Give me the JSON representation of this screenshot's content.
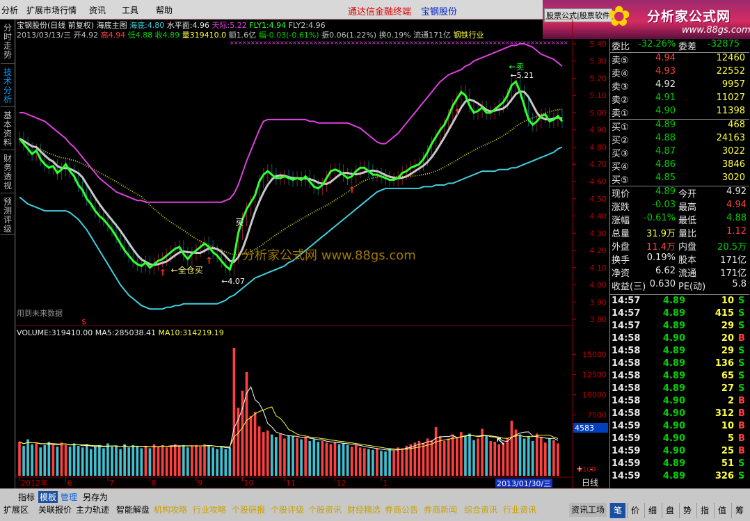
{
  "menu": {
    "items": [
      "分析",
      "扩展市场行情",
      "资讯",
      "工具",
      "帮助"
    ],
    "brand": "通达信金融终端",
    "stock_name": "宝钢股份"
  },
  "logo": {
    "ad_label": "股票公式|股票软件",
    "brand": "分析家公式网",
    "url": "www.88gs.com"
  },
  "left_tabs": [
    "分时走势",
    "技术分析",
    "基本资料",
    "财务透视",
    "预测评级"
  ],
  "chart": {
    "title_line": {
      "name": "宝钢股份(日线 前复权)",
      "indicator": "海底主图",
      "haidi_label": "海底:",
      "haidi": "4.80",
      "shuiping_label": "水平面:",
      "shuiping": "4.96",
      "tianji_label": "天际:",
      "tianji": "5.22",
      "fly1_label": "FLY1:",
      "fly1": "4.94",
      "fly2_label": "FLY2:",
      "fly2": "4.96"
    },
    "ohlc_line": {
      "date": "2013/03/13/三",
      "open_label": "开",
      "open": "4.92",
      "high_label": "高",
      "high": "4.94",
      "low_label": "低",
      "low": "4.88",
      "close_label": "收",
      "close": "4.89",
      "vol_label": "量",
      "vol": "319410.0",
      "amount": "额1.6亿",
      "change_label": "幅",
      "change": "-0.03(-0.61%)",
      "amplitude": "振0.06(1.22%)",
      "turnover": "换0.19%",
      "float": "流通171亿",
      "sector": "钢铁行业"
    },
    "y_ticks": [
      "5.40",
      "5.30",
      "5.20",
      "5.10",
      "5.00",
      "4.90",
      "4.80",
      "4.70",
      "4.60",
      "4.50",
      "4.40",
      "4.30",
      "4.20",
      "4.10",
      "4.00",
      "3.90",
      "3.80"
    ],
    "annotations": {
      "buy_label": "买",
      "sell_label": "卖",
      "full_position_buy": "全仓买",
      "low_value": "4.07",
      "high_value": "5.21",
      "future_data_note": "用到未来数据",
      "watermark": "分析家公式网 www.88gs.com"
    },
    "volume_line": {
      "vol_label": "VOLUME:",
      "vol": "319410.00",
      "ma5_label": "MA5:",
      "ma5": "285038.41",
      "ma10_label": "MA10:",
      "ma10": "314219.19"
    },
    "vol_ticks": [
      "15000",
      "12500",
      "10000",
      "7500"
    ],
    "vol_cursor": "4583",
    "vol_unit": "X100",
    "x_ticks": [
      "2012年",
      "6",
      "7",
      "8",
      "9",
      "10",
      "11",
      "12",
      "1"
    ],
    "date_cursor": "2013/01/30/三",
    "period": "日线",
    "zoom_plus": "+",
    "zoom_minus": "-"
  },
  "chart_data": {
    "type": "line",
    "title": "宝钢股份(日线 前复权)",
    "ylim": [
      3.78,
      5.42
    ],
    "series": [
      {
        "name": "收",
        "values": [
          4.85,
          4.82,
          4.79,
          4.76,
          4.78,
          4.73,
          4.7,
          4.68,
          4.69,
          4.65,
          4.67,
          4.7,
          4.66,
          4.63,
          4.58,
          4.55,
          4.5,
          4.47,
          4.43,
          4.4,
          4.38,
          4.35,
          4.32,
          4.28,
          4.24,
          4.2,
          4.17,
          4.14,
          4.12,
          4.11,
          4.13,
          4.1,
          4.12,
          4.14,
          4.15,
          4.17,
          4.19,
          4.21,
          4.22,
          4.18,
          4.15,
          4.18,
          4.2,
          4.22,
          4.24,
          4.22,
          4.19,
          4.17,
          4.14,
          4.11,
          4.09,
          4.16,
          4.3,
          4.38,
          4.44,
          4.48,
          4.52,
          4.6,
          4.64,
          4.66,
          4.64,
          4.62,
          4.62,
          4.63,
          4.62,
          4.61,
          4.62,
          4.61,
          4.63,
          4.6,
          4.57,
          4.56,
          4.58,
          4.62,
          4.66,
          4.67,
          4.66,
          4.64,
          4.62,
          4.63,
          4.66,
          4.68,
          4.68,
          4.66,
          4.64,
          4.64,
          4.63,
          4.62,
          4.61,
          4.61,
          4.62,
          4.65,
          4.66,
          4.68,
          4.69,
          4.7,
          4.73,
          4.77,
          4.82,
          4.86,
          4.9,
          4.93,
          4.98,
          5.04,
          5.08,
          5.12,
          5.1,
          5.04,
          5.0,
          5.01,
          5.03,
          5.0,
          5.0,
          5.02,
          5.04,
          5.06,
          5.1,
          5.16,
          5.18,
          5.12,
          5.04,
          4.96,
          4.93,
          4.95,
          4.98,
          4.99,
          4.95,
          4.96,
          4.98,
          4.95
        ]
      },
      {
        "name": "天际",
        "values": [
          5.0,
          5.0,
          4.99,
          4.98,
          4.97,
          4.96,
          4.95,
          4.93,
          4.91,
          4.89,
          4.87,
          4.85,
          4.82,
          4.8,
          4.77,
          4.74,
          4.71,
          4.68,
          4.65,
          4.62,
          4.6,
          4.58,
          4.56,
          4.54,
          4.53,
          4.52,
          4.51,
          4.5,
          4.49,
          4.49,
          4.48,
          4.48,
          4.48,
          4.48,
          4.48,
          4.48,
          4.48,
          4.48,
          4.48,
          4.48,
          4.48,
          4.48,
          4.48,
          4.48,
          4.48,
          4.48,
          4.48,
          4.48,
          4.48,
          4.49,
          4.5,
          4.53,
          4.58,
          4.65,
          4.72,
          4.78,
          4.84,
          4.9,
          4.95,
          4.96,
          4.96,
          4.96,
          4.96,
          4.96,
          4.96,
          4.96,
          4.96,
          4.96,
          4.96,
          4.95,
          4.95,
          4.94,
          4.94,
          4.94,
          4.94,
          4.94,
          4.94,
          4.94,
          4.94,
          4.93,
          4.92,
          4.91,
          4.89,
          4.87,
          4.85,
          4.83,
          4.82,
          4.82,
          4.84,
          4.86,
          4.88,
          4.91,
          4.94,
          4.97,
          5.0,
          5.03,
          5.06,
          5.09,
          5.12,
          5.15,
          5.18,
          5.2,
          5.22,
          5.23,
          5.24,
          5.25,
          5.27,
          5.28,
          5.3,
          5.31,
          5.32,
          5.33,
          5.34,
          5.35,
          5.36,
          5.37,
          5.38,
          5.39,
          5.39,
          5.4,
          5.4,
          5.39,
          5.38,
          5.36,
          5.34,
          5.33,
          5.32,
          5.31,
          5.29,
          5.27
        ]
      },
      {
        "name": "海底",
        "values": [
          4.51,
          4.49,
          4.47,
          4.46,
          4.45,
          4.44,
          4.43,
          4.43,
          4.43,
          4.43,
          4.43,
          4.43,
          4.42,
          4.4,
          4.38,
          4.35,
          4.32,
          4.28,
          4.24,
          4.2,
          4.16,
          4.12,
          4.08,
          4.04,
          4.0,
          3.97,
          3.94,
          3.92,
          3.9,
          3.88,
          3.87,
          3.86,
          3.86,
          3.86,
          3.86,
          3.87,
          3.87,
          3.88,
          3.88,
          3.89,
          3.89,
          3.89,
          3.89,
          3.89,
          3.89,
          3.89,
          3.89,
          3.89,
          3.9,
          3.91,
          3.93,
          3.94,
          3.96,
          3.98,
          4.0,
          4.02,
          4.04,
          4.05,
          4.06,
          4.07,
          4.08,
          4.09,
          4.1,
          4.11,
          4.13,
          4.14,
          4.16,
          4.18,
          4.2,
          4.22,
          4.24,
          4.26,
          4.28,
          4.3,
          4.32,
          4.34,
          4.36,
          4.38,
          4.4,
          4.42,
          4.44,
          4.46,
          4.48,
          4.5,
          4.52,
          4.54,
          4.55,
          4.56,
          4.56,
          4.56,
          4.56,
          4.56,
          4.56,
          4.56,
          4.56,
          4.56,
          4.57,
          4.57,
          4.57,
          4.58,
          4.58,
          4.58,
          4.59,
          4.59,
          4.6,
          4.61,
          4.62,
          4.63,
          4.64,
          4.65,
          4.66,
          4.66,
          4.66,
          4.66,
          4.67,
          4.67,
          4.67,
          4.68,
          4.68,
          4.69,
          4.7,
          4.71,
          4.72,
          4.73,
          4.74,
          4.75,
          4.76,
          4.77,
          4.79,
          4.8
        ]
      }
    ],
    "volume": {
      "ylim": [
        0,
        17000
      ],
      "values": [
        4200,
        3700,
        4500,
        3900,
        4100,
        3500,
        3800,
        4200,
        3900,
        3600,
        4100,
        3800,
        3600,
        4000,
        3700,
        3500,
        3900,
        3300,
        3600,
        3800,
        3400,
        4000,
        3600,
        3700,
        3300,
        3900,
        3500,
        3800,
        3600,
        3400,
        3700,
        3400,
        3900,
        3600,
        3800,
        3500,
        3700,
        3900,
        3600,
        3800,
        3500,
        3700,
        3800,
        3600,
        3900,
        3700,
        3500,
        3300,
        3600,
        3300,
        3500,
        15800,
        8400,
        10500,
        12800,
        7400,
        7900,
        6100,
        5400,
        5600,
        5100,
        4800,
        5200,
        4600,
        5000,
        4900,
        4700,
        4500,
        4800,
        4300,
        4500,
        4200,
        4300,
        4100,
        3900,
        4200,
        3900,
        4000,
        3800,
        3600,
        3800,
        3500,
        3400,
        3300,
        3200,
        3400,
        3100,
        3000,
        3300,
        3100,
        3500,
        3400,
        3700,
        3900,
        4100,
        4300,
        4000,
        4600,
        4400,
        6000,
        4900,
        4300,
        4600,
        5100,
        4700,
        5400,
        4900,
        5200,
        4400,
        4600,
        5800,
        5000,
        4300,
        4200,
        3900,
        4100,
        4700,
        6800,
        5700,
        5100,
        4600,
        4900,
        4300,
        5200,
        4800,
        4100,
        4600,
        4400,
        4000
      ]
    },
    "ylabel": ""
  },
  "quote": {
    "weibi_label": "委比",
    "weibi": "-32.26%",
    "weicha_label": "委差",
    "weicha": "-32875",
    "sells": [
      {
        "label": "卖⑤",
        "price": "4.94",
        "vol": "12460",
        "pc": "red"
      },
      {
        "label": "卖④",
        "price": "4.93",
        "vol": "22552",
        "pc": "red"
      },
      {
        "label": "卖③",
        "price": "4.92",
        "vol": "9957",
        "pc": "white"
      },
      {
        "label": "卖②",
        "price": "4.91",
        "vol": "11027",
        "pc": "green"
      },
      {
        "label": "卖①",
        "price": "4.90",
        "vol": "11398",
        "pc": "green"
      }
    ],
    "buys": [
      {
        "label": "买①",
        "price": "4.89",
        "vol": "468",
        "pc": "green"
      },
      {
        "label": "买②",
        "price": "4.88",
        "vol": "24163",
        "pc": "green"
      },
      {
        "label": "买③",
        "price": "4.87",
        "vol": "3022",
        "pc": "green"
      },
      {
        "label": "买④",
        "price": "4.86",
        "vol": "3846",
        "pc": "green"
      },
      {
        "label": "买⑤",
        "price": "4.85",
        "vol": "3020",
        "pc": "green"
      }
    ],
    "stats": [
      {
        "l1": "现价",
        "v1": "4.89",
        "c1": "green",
        "l2": "今开",
        "v2": "4.92",
        "c2": "white"
      },
      {
        "l1": "涨跌",
        "v1": "-0.03",
        "c1": "green",
        "l2": "最高",
        "v2": "4.94",
        "c2": "red"
      },
      {
        "l1": "涨幅",
        "v1": "-0.61%",
        "c1": "green",
        "l2": "最低",
        "v2": "4.88",
        "c2": "green"
      },
      {
        "l1": "总量",
        "v1": "31.9万",
        "c1": "yellow",
        "l2": "量比",
        "v2": "1.12",
        "c2": "red"
      },
      {
        "l1": "外盘",
        "v1": "11.4万",
        "c1": "red",
        "l2": "内盘",
        "v2": "20.5万",
        "c2": "green"
      },
      {
        "l1": "换手",
        "v1": "0.19%",
        "c1": "white",
        "l2": "股本",
        "v2": "171亿",
        "c2": "white"
      },
      {
        "l1": "净资",
        "v1": "6.62",
        "c1": "white",
        "l2": "流通",
        "v2": "171亿",
        "c2": "white"
      },
      {
        "l1": "收益(三)",
        "v1": "0.630",
        "c1": "white",
        "l2": "PE(动)",
        "v2": "5.8",
        "c2": "white"
      }
    ],
    "ticks": [
      {
        "t": "14:57",
        "p": "4.89",
        "v": "10",
        "s": "S"
      },
      {
        "t": "14:57",
        "p": "4.89",
        "v": "415",
        "s": "S"
      },
      {
        "t": "14:57",
        "p": "4.89",
        "v": "29",
        "s": "S"
      },
      {
        "t": "14:58",
        "p": "4.90",
        "v": "20",
        "s": "B"
      },
      {
        "t": "14:58",
        "p": "4.89",
        "v": "29",
        "s": "S"
      },
      {
        "t": "14:58",
        "p": "4.89",
        "v": "136",
        "s": "S"
      },
      {
        "t": "14:58",
        "p": "4.89",
        "v": "65",
        "s": "S"
      },
      {
        "t": "14:58",
        "p": "4.89",
        "v": "27",
        "s": "S"
      },
      {
        "t": "14:58",
        "p": "4.90",
        "v": "2",
        "s": "B"
      },
      {
        "t": "14:58",
        "p": "4.90",
        "v": "312",
        "s": "B"
      },
      {
        "t": "14:59",
        "p": "4.90",
        "v": "10",
        "s": "B"
      },
      {
        "t": "14:59",
        "p": "4.90",
        "v": "5",
        "s": "B"
      },
      {
        "t": "14:59",
        "p": "4.90",
        "v": "25",
        "s": "B"
      },
      {
        "t": "14:59",
        "p": "4.89",
        "v": "51",
        "s": "S"
      },
      {
        "t": "14:59",
        "p": "4.89",
        "v": "326",
        "s": "S"
      }
    ]
  },
  "bottom": {
    "view_tabs": [
      "指标",
      "模板",
      "管理",
      "另存为"
    ],
    "cat_tabs": [
      "扩展区",
      "关联报价",
      "主力轨迹",
      "智能解盘",
      "机构攻略",
      "行业攻略",
      "个股研报",
      "个股评级",
      "个股资讯",
      "财经精选",
      "券商公告",
      "券商新闻",
      "综合资讯",
      "行业资讯"
    ],
    "info_factory": "资讯工场",
    "quote_tabs": [
      "笔",
      "价",
      "细",
      "盘",
      "势",
      "指",
      "值",
      "筹"
    ]
  },
  "colors": {
    "up": "#ff4040",
    "down": "#00d000",
    "pink_band": "#e040e0",
    "cyan_band": "#40d0e0",
    "green_line": "#30ff30",
    "gray_line": "#c8c8c8",
    "dot_line": "#d0d000"
  }
}
